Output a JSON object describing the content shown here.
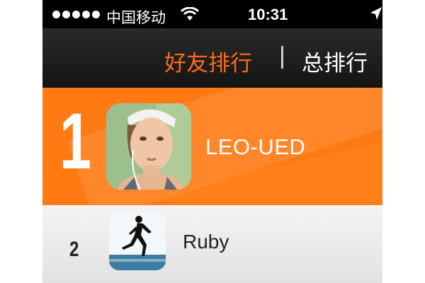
{
  "status_bar": {
    "carrier": "中国移动",
    "time": "10:31",
    "signal_bars": 5
  },
  "tabs": {
    "friends": "好友排行",
    "separator": "|",
    "total": "总排行",
    "active_color": "#ff6a1a"
  },
  "leaderboard": [
    {
      "rank": "1",
      "name": "LEO-UED",
      "avatar": "woman-portrait-avatar"
    },
    {
      "rank": "2",
      "name": "Ruby",
      "avatar": "runner-silhouette-avatar"
    }
  ],
  "colors": {
    "highlight_row": "#ff7a12",
    "header": "#1c1c1c"
  }
}
